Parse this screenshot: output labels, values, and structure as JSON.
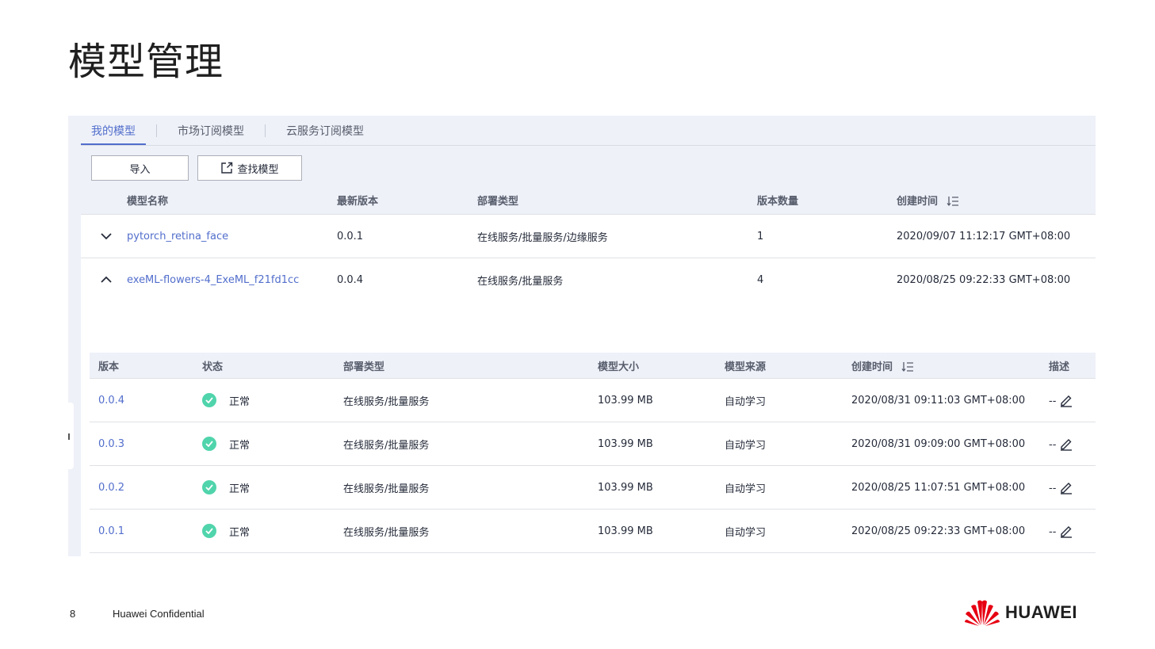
{
  "slide": {
    "title": "模型管理",
    "page_number": "8",
    "confidential": "Huawei Confidential",
    "brand": "HUAWEI"
  },
  "tabs": [
    {
      "label": "我的模型",
      "active": true
    },
    {
      "label": "市场订阅模型",
      "active": false
    },
    {
      "label": "云服务订阅模型",
      "active": false
    }
  ],
  "toolbar": {
    "import_label": "导入",
    "find_label": "查找模型"
  },
  "models": {
    "headers": {
      "name": "模型名称",
      "latest_version": "最新版本",
      "deploy_type": "部署类型",
      "version_count": "版本数量",
      "created": "创建时间"
    },
    "rows": [
      {
        "name": "pytorch_retina_face",
        "latest_version": "0.0.1",
        "deploy_type": "在线服务/批量服务/边缘服务",
        "version_count": "1",
        "created": "2020/09/07 11:12:17 GMT+08:00",
        "expanded": false
      },
      {
        "name": "exeML-flowers-4_ExeML_f21fd1cc",
        "latest_version": "0.0.4",
        "deploy_type": "在线服务/批量服务",
        "version_count": "4",
        "created": "2020/08/25 09:22:33 GMT+08:00",
        "expanded": true
      }
    ]
  },
  "versions": {
    "headers": {
      "version": "版本",
      "status": "状态",
      "deploy_type": "部署类型",
      "size": "模型大小",
      "source": "模型来源",
      "created": "创建时间",
      "desc": "描述"
    },
    "rows": [
      {
        "version": "0.0.4",
        "status": "正常",
        "deploy_type": "在线服务/批量服务",
        "size": "103.99 MB",
        "source": "自动学习",
        "created": "2020/08/31 09:11:03 GMT+08:00",
        "desc": "--"
      },
      {
        "version": "0.0.3",
        "status": "正常",
        "deploy_type": "在线服务/批量服务",
        "size": "103.99 MB",
        "source": "自动学习",
        "created": "2020/08/31 09:09:00 GMT+08:00",
        "desc": "--"
      },
      {
        "version": "0.0.2",
        "status": "正常",
        "deploy_type": "在线服务/批量服务",
        "size": "103.99 MB",
        "source": "自动学习",
        "created": "2020/08/25 11:07:51 GMT+08:00",
        "desc": "--"
      },
      {
        "version": "0.0.1",
        "status": "正常",
        "deploy_type": "在线服务/批量服务",
        "size": "103.99 MB",
        "source": "自动学习",
        "created": "2020/08/25 09:22:33 GMT+08:00",
        "desc": "--"
      }
    ]
  },
  "colors": {
    "accent": "#526ecc",
    "status_ok": "#50d4ab",
    "panel_bg": "#eef1f8",
    "brand_red": "#e60012"
  },
  "icons": {
    "expand": "chevron-down-icon",
    "collapse": "chevron-up-icon",
    "sort": "sort-icon",
    "find": "external-link-icon",
    "status": "check-circle-icon",
    "edit": "pencil-icon",
    "logo": "huawei-flower-logo"
  }
}
